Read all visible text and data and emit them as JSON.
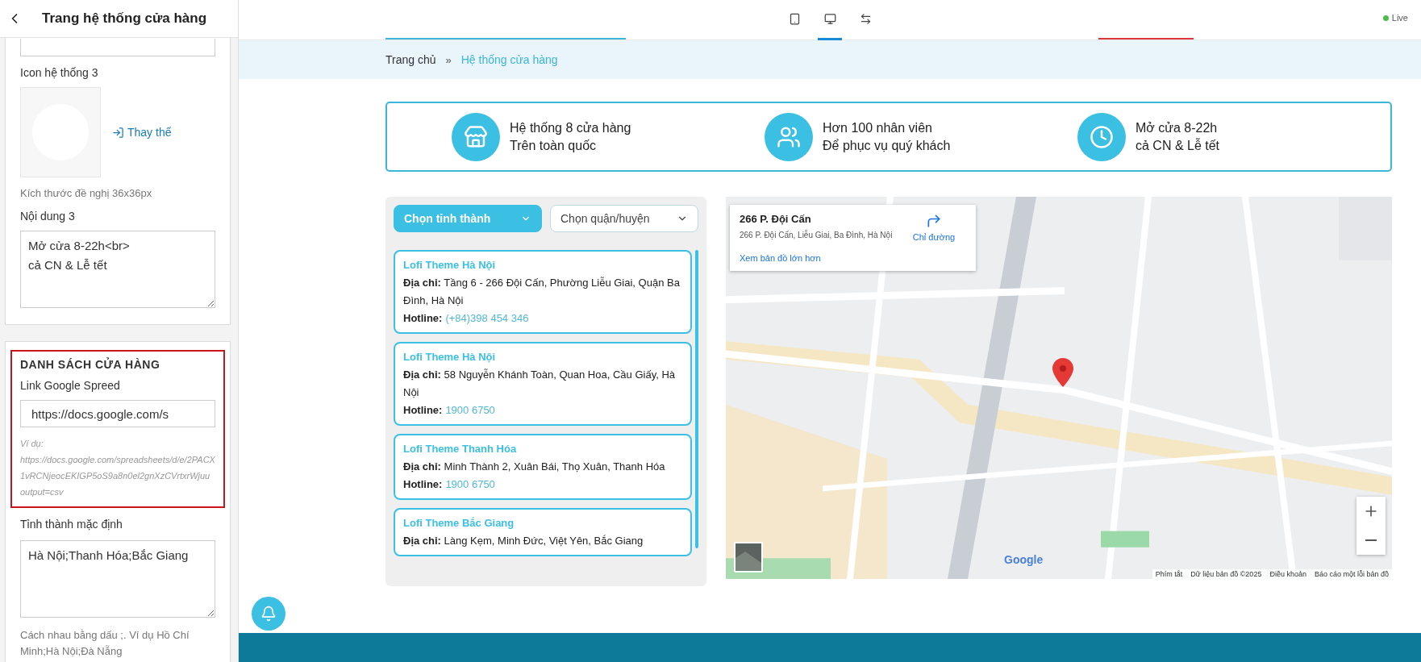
{
  "sidebar": {
    "title": "Trang hệ thống cửa hàng",
    "sections": [
      {
        "highlighted": false,
        "fields": [
          {
            "label": "Icon hệ thống 3",
            "action": "Thay thế",
            "hint": "Kích thước đề nghị 36x36px"
          },
          {
            "kind": "textarea",
            "label": "Nội dung 3",
            "value": "Mở cửa 8-22h<br>\ncả CN & Lễ tết"
          }
        ]
      },
      {
        "highlighted": true,
        "heading": "DANH SÁCH CỬA HÀNG",
        "fields": [
          {
            "kind": "input",
            "label": "Link Google Spreed",
            "value": "https://docs.google.com/s",
            "example_lines": [
              "Ví dụ:",
              "https://docs.google.com/spreadsheets/d/e/2PACX",
              "1vRCNjeocEKIGP5oS9a8n0el2gnXzCVrtxrWjuu",
              "output=csv"
            ]
          },
          {
            "kind": "textarea",
            "label": "Tỉnh thành mặc định",
            "value": "Hà Nội;Thanh Hóa;Bắc Giang",
            "hint": "Cách nhau bằng dấu ;. Ví dụ Hồ Chí Minh;Hà Nội;Đà Nẵng"
          }
        ]
      }
    ]
  },
  "toolbar": {
    "devices": [
      {
        "kind": "tablet",
        "selected": false
      },
      {
        "kind": "desktop",
        "selected": true
      },
      {
        "kind": "fullwidth",
        "selected": false
      }
    ],
    "status": "Live"
  },
  "breadcrumb": [
    {
      "label": "Trang chủ",
      "selected": false
    },
    {
      "label": "Hệ thống cửa hàng",
      "selected": true
    }
  ],
  "breadcrumb_separator": "»",
  "features": [
    {
      "kind": "store",
      "line1": "Hệ thống 8 cửa hàng",
      "line2": "Trên toàn quốc"
    },
    {
      "kind": "users",
      "line1": "Hơn 100 nhân viên",
      "line2": "Để phục vụ quý khách"
    },
    {
      "kind": "clock",
      "line1": "Mở cửa 8-22h",
      "line2": "cả CN & Lễ tết"
    }
  ],
  "filters": [
    {
      "placeholder": "Chọn tỉnh thành",
      "selected": true
    },
    {
      "placeholder": "Chọn quận/huyện",
      "selected": false
    }
  ],
  "stores": [
    {
      "name": "Lofi Theme Hà Nội",
      "address": "**Địa chỉ:** Tầng 6 - 266 Đội Cấn, Phường Liễu Giai, Quận Ba Đình, Hà Nội",
      "hotline_label": "Hotline:",
      "hotline": "(+84)398 454 346"
    },
    {
      "name": "Lofi Theme Hà Nội",
      "address": "**Địa chỉ:** 58 Nguyễn Khánh Toàn, Quan Hoa, Cầu Giấy, Hà Nội",
      "hotline_label": "Hotline:",
      "hotline": "1900 6750"
    },
    {
      "name": "Lofi Theme Thanh Hóa",
      "address": "**Địa chỉ:** Minh Thành 2, Xuân Bái, Thọ Xuân, Thanh Hóa",
      "hotline_label": "Hotline:",
      "hotline": "1900 6750"
    },
    {
      "name": "Lofi Theme Bắc Giang",
      "address": "**Địa chỉ:** Làng Kẹm, Minh Đức, Việt Yên, Bắc Giang"
    }
  ],
  "map": {
    "card": {
      "title": "266 P. Đội Cấn",
      "address": "266 P. Đội Cấn, Liễu Giai, Ba Đình, Hà Nội",
      "directions": "Chỉ đường",
      "larger_map": "Xem bản đồ lớn hơn"
    },
    "logo": "Google",
    "footer": [
      "Phím tắt",
      "Dữ liệu bản đồ ©2025",
      "Điều khoản",
      "Báo cáo một lỗi bản đồ"
    ]
  }
}
